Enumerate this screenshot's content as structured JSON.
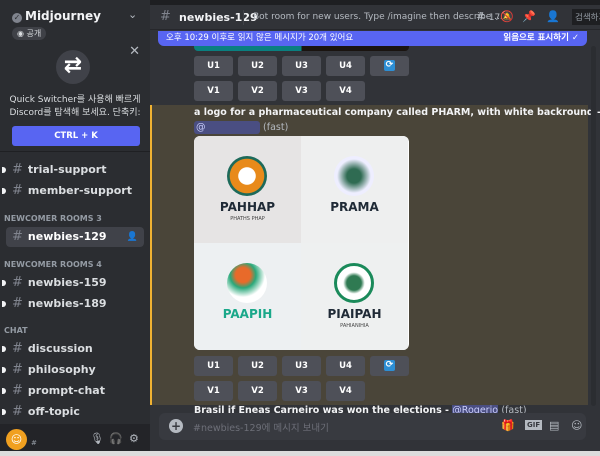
{
  "server": {
    "name": "Midjourney",
    "badge": "공개"
  },
  "quick_switcher": {
    "text": "Quick Switcher를 사용해 빠르게 Discord를 탐색해 보세요. 단축키:",
    "button": "CTRL + K"
  },
  "channels": [
    {
      "name": "trial-support"
    },
    {
      "name": "member-support"
    },
    {
      "category": "NEWCOMER ROOMS 3"
    },
    {
      "name": "newbies-129",
      "selected": true
    },
    {
      "category": "NEWCOMER ROOMS 4"
    },
    {
      "name": "newbies-159"
    },
    {
      "name": "newbies-189"
    },
    {
      "category": "CHAT"
    },
    {
      "name": "discussion"
    },
    {
      "name": "philosophy"
    },
    {
      "name": "prompt-chat"
    },
    {
      "name": "off-topic"
    }
  ],
  "user": {
    "name": "#"
  },
  "header": {
    "channel": "newbies-129",
    "topic": "Bot room for new users. Type /imagine then describe ...",
    "threads": "17",
    "search": "검색하기"
  },
  "banner": {
    "text": "오후 10:29 이후로 읽지 않은 메시지가 20개 있어요",
    "action": "읽음으로 표시하기"
  },
  "buttons": {
    "u": [
      "U1",
      "U2",
      "U3",
      "U4"
    ],
    "v": [
      "V1",
      "V2",
      "V3",
      "V4"
    ],
    "reroll": "⟳"
  },
  "message": {
    "prompt": "a logo for a pharmaceutical company called PHARM, with white backround -",
    "mention": "@",
    "speed": "(fast)",
    "tiles": [
      {
        "title": "PAHHAP",
        "sub": "PHATHS PHAP"
      },
      {
        "title": "PRAMA",
        "sub": ""
      },
      {
        "title": "PAAPIH",
        "sub": ""
      },
      {
        "title": "PIAIPAH",
        "sub": "PAHIANIHIA"
      }
    ]
  },
  "next_message": {
    "text": "Brasil if Eneas Carneiro was won the elections -",
    "mention": "@Rogerio",
    "speed": "(fast)"
  },
  "input": {
    "placeholder": "#newbies-129에 메시지 보내기",
    "gif": "GIF"
  },
  "colors": {
    "accent": "#5865f2",
    "highlight": "#f0b232"
  }
}
